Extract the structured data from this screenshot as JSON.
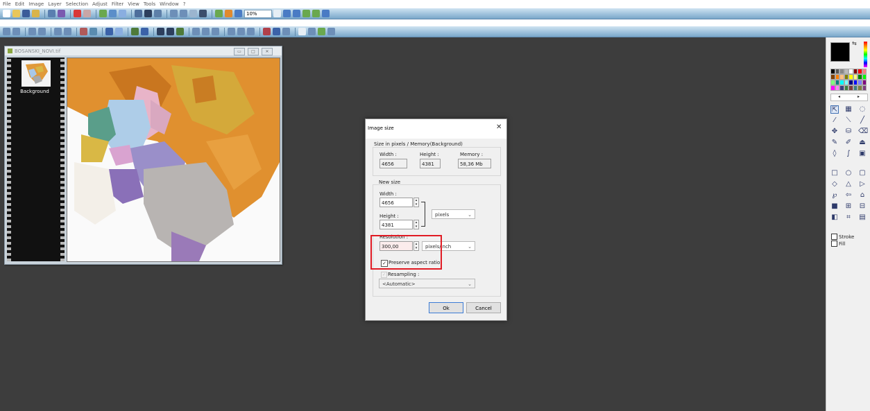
{
  "menubar": {
    "items": [
      "File",
      "Edit",
      "Image",
      "Layer",
      "Selection",
      "Adjust",
      "Filter",
      "View",
      "Tools",
      "Window",
      "?"
    ]
  },
  "toolbar": {
    "zoom_value": "10%"
  },
  "document": {
    "title": "BOSANSKI_NOVI.tif",
    "layer_name": "Background"
  },
  "dialog": {
    "title": "Image size",
    "close_glyph": "✕",
    "current_size": {
      "group_label": "Size in pixels / Memory(Background)",
      "width_label": "Width :",
      "width_value": "4656",
      "height_label": "Height :",
      "height_value": "4381",
      "memory_label": "Memory :",
      "memory_value": "58,36 Mb"
    },
    "new_size": {
      "group_label": "New size",
      "width_label": "Width :",
      "width_value": "4656",
      "height_label": "Height :",
      "height_value": "4381",
      "unit_value": "pixels",
      "resolution_label": "Resolution :",
      "resolution_value": "300,00",
      "resolution_unit": "pixels/inch",
      "preserve_label": "Preserve aspect ratio",
      "preserve_checked": true,
      "resampling_label": "Resampling :",
      "resampling_value": "<Automatic>"
    },
    "ok_label": "Ok",
    "cancel_label": "Cancel"
  },
  "tools_panel": {
    "stroke_label": "Stroke",
    "fill_label": "Fill",
    "foreground_color": "#000000"
  },
  "colors": {
    "highlight": "#e01b24",
    "workspace": "#3d3d3d",
    "toolbar": "#9fc2dc"
  }
}
